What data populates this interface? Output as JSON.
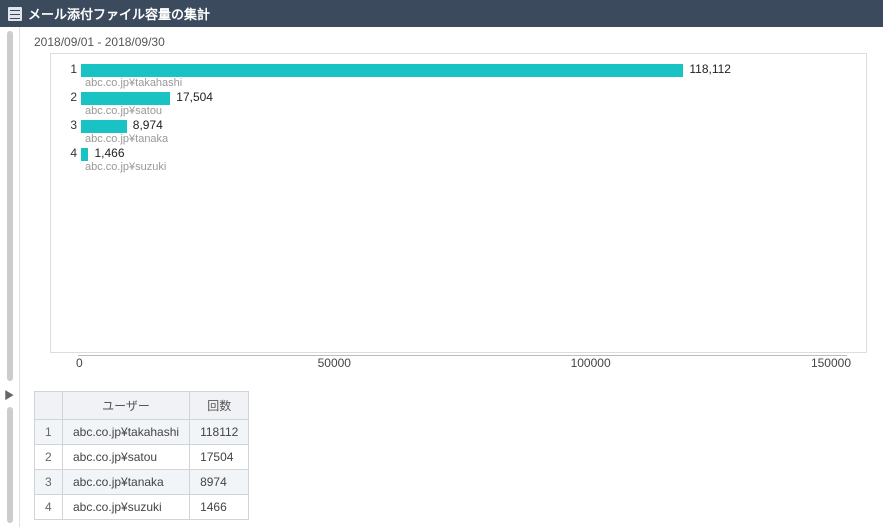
{
  "header": {
    "title": "メール添付ファイル容量の集計"
  },
  "date_range": "2018/09/01 - 2018/09/30",
  "expand_toggle": "▶",
  "chart_data": {
    "type": "bar",
    "orientation": "horizontal",
    "xlabel": "",
    "ylabel": "",
    "xlim": [
      0,
      150000
    ],
    "xticks": [
      0,
      50000,
      100000,
      150000
    ],
    "categories": [
      "1",
      "2",
      "3",
      "4"
    ],
    "series": [
      {
        "name": "回数",
        "values": [
          118112,
          17504,
          8974,
          1466
        ]
      }
    ],
    "labels": [
      "abc.co.jp¥takahashi",
      "abc.co.jp¥satou",
      "abc.co.jp¥tanaka",
      "abc.co.jp¥suzuki"
    ],
    "value_labels": [
      "118,112",
      "17,504",
      "8,974",
      "1,466"
    ]
  },
  "axis_ticks": [
    "0",
    "50000",
    "100000",
    "150000"
  ],
  "table": {
    "columns": {
      "index": "",
      "user": "ユーザー",
      "count": "回数"
    },
    "rows": [
      {
        "idx": "1",
        "user": "abc.co.jp¥takahashi",
        "count": "118112"
      },
      {
        "idx": "2",
        "user": "abc.co.jp¥satou",
        "count": "17504"
      },
      {
        "idx": "3",
        "user": "abc.co.jp¥tanaka",
        "count": "8974"
      },
      {
        "idx": "4",
        "user": "abc.co.jp¥suzuki",
        "count": "1466"
      }
    ]
  }
}
